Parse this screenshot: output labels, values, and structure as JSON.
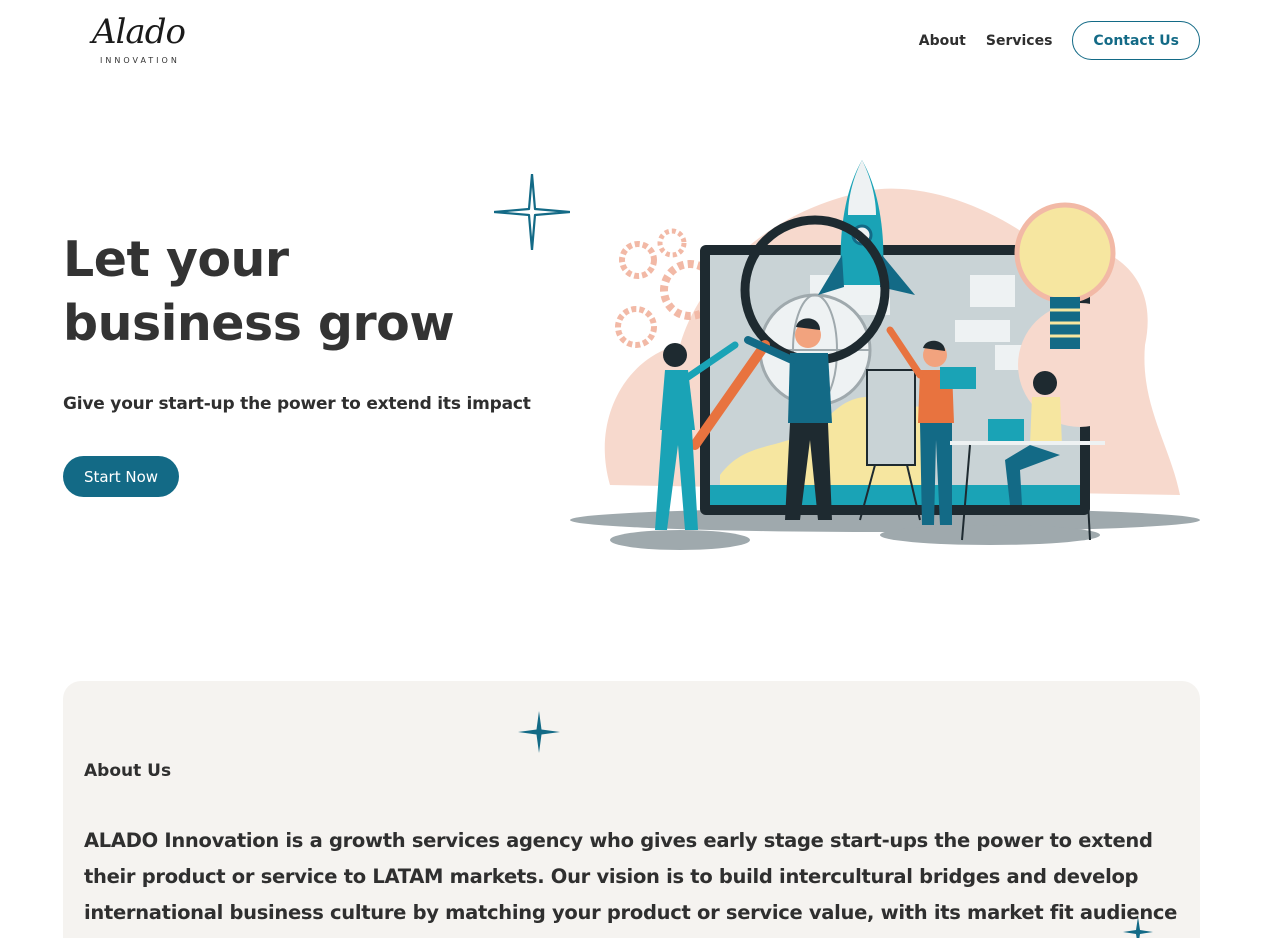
{
  "brand": {
    "logo_script": "Alado",
    "logo_sub": "INNOVATION"
  },
  "nav": {
    "items": [
      {
        "label": "About"
      },
      {
        "label": "Services"
      }
    ],
    "contact_label": "Contact Us"
  },
  "hero": {
    "title": "Let your business grow",
    "subtitle": "Give your start-up the power to extend its impact",
    "cta_label": "Start Now",
    "illustration_icon": "business-growth-illustration"
  },
  "about": {
    "label": "About Us",
    "text": "ALADO Innovation is a growth services agency who gives early stage start-ups the power to extend their product or service to LATAM markets. Our vision is to build intercultural bridges and develop international business culture by matching your product or service value, with its market fit audience or partners."
  },
  "colors": {
    "accent": "#136a86",
    "section_bg": "#f5f3f0",
    "text": "#2f2f2f"
  }
}
